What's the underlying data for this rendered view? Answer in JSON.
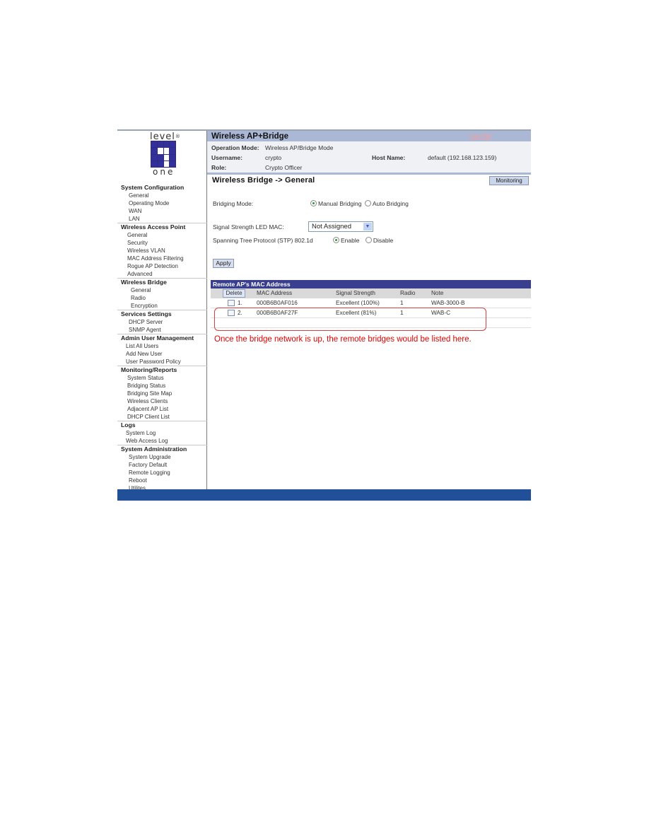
{
  "logo": {
    "top_text": "level",
    "mark": "®",
    "bottom_text": "one"
  },
  "sidebar": {
    "sections": [
      {
        "heading": "System Configuration",
        "indent": "i1",
        "items": [
          "General",
          "Operating Mode",
          "WAN",
          "LAN"
        ]
      },
      {
        "heading": "Wireless Access Point",
        "indent": "i4",
        "items": [
          "General",
          "Security",
          "Wireless VLAN",
          "MAC Address Filtering",
          "Rogue AP Detection",
          "Advanced"
        ]
      },
      {
        "heading": "Wireless Bridge",
        "indent": "i3",
        "items": [
          "General",
          "Radio",
          "Encryption"
        ]
      },
      {
        "heading": "Services Settings",
        "indent": "i1",
        "items": [
          "DHCP Server",
          "SNMP Agent"
        ]
      },
      {
        "heading": "Admin User Management",
        "indent": "i2",
        "items": [
          "List All Users",
          "Add New User",
          "User Password Policy"
        ]
      },
      {
        "heading": "Monitoring/Reports",
        "indent": "i4",
        "items": [
          "System Status",
          "Bridging Status",
          "Bridging Site Map",
          "Wireless Clients",
          "Adjacent AP List",
          "DHCP Client List"
        ]
      },
      {
        "heading": "Logs",
        "indent": "i2",
        "items": [
          "System Log",
          "Web Access Log"
        ]
      },
      {
        "heading": "System Administration",
        "indent": "i1",
        "items": [
          "System Upgrade",
          "Factory Default",
          "Remote Logging",
          "Reboot",
          "Utilites"
        ]
      }
    ]
  },
  "header": {
    "title": "Wireless AP+Bridge",
    "logout_label": "Log Out",
    "operation_mode_label": "Operation Mode:",
    "operation_mode_value": "Wireless AP/Bridge Mode",
    "username_label": "Username:",
    "username_value": "crypto",
    "role_label": "Role:",
    "role_value": "Crypto Officer",
    "host_name_label": "Host Name:",
    "host_name_value": "default (192.168.123.159)"
  },
  "page": {
    "title": "Wireless Bridge -> General",
    "monitoring_label": "Monitoring",
    "bridging_mode_label": "Bridging Mode:",
    "bridging_options": [
      "Manual Bridging",
      "Auto Bridging"
    ],
    "bridging_selected": "Manual Bridging",
    "led_mac_label": "Signal Strength LED MAC:",
    "led_mac_value": "Not Assigned",
    "stp_label": "Spanning Tree Protocol (STP) 802.1d",
    "stp_options": [
      "Enable",
      "Disable"
    ],
    "stp_selected": "Enable",
    "apply_label": "Apply"
  },
  "remote_table": {
    "title": "Remote AP's MAC Address",
    "delete_label": "Delete",
    "columns": [
      "MAC Address",
      "Signal Strength",
      "Radio",
      "Note"
    ],
    "rows": [
      {
        "index": "1.",
        "mac": "000B6B0AF016",
        "signal": "Excellent (100%)",
        "radio": "1",
        "note": "WAB-3000-B",
        "checked": false
      },
      {
        "index": "2.",
        "mac": "000B6B0AF27F",
        "signal": "Excellent (81%)",
        "radio": "1",
        "note": "WAB-C",
        "checked": false
      }
    ]
  },
  "annotation": "Once the bridge network is up, the remote bridges would be listed here.",
  "colors": {
    "title_bar": "#aab8d6",
    "table_header": "#3a3e8e",
    "footer": "#214f98",
    "annotation": "#e00000"
  }
}
